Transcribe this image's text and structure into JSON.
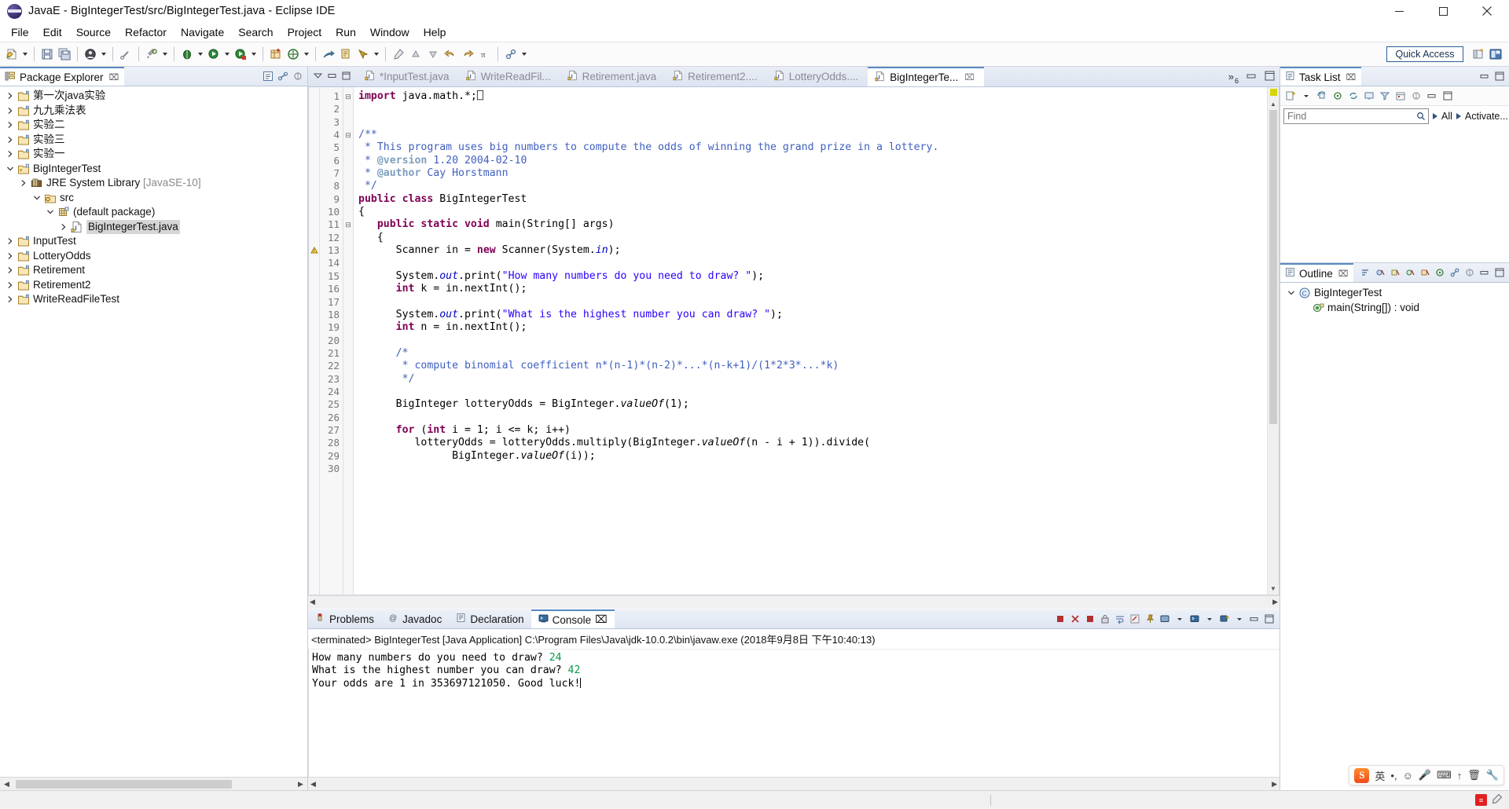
{
  "window": {
    "title": "JavaE - BigIntegerTest/src/BigIntegerTest.java - Eclipse IDE",
    "app_icon": "eclipse-icon",
    "minimize": "–",
    "maximize": "❐",
    "close": "✕"
  },
  "menu": [
    {
      "label": "File"
    },
    {
      "label": "Edit"
    },
    {
      "label": "Source"
    },
    {
      "label": "Refactor"
    },
    {
      "label": "Navigate"
    },
    {
      "label": "Search"
    },
    {
      "label": "Project"
    },
    {
      "label": "Run"
    },
    {
      "label": "Window"
    },
    {
      "label": "Help"
    }
  ],
  "toolbar": {
    "quick_access_placeholder": "Quick Access",
    "buttons": [
      "new-wizard-button",
      "new-wizard-dropdown",
      "save-button",
      "save-all-button",
      "print-button",
      "print-dropdown",
      "build-button",
      "external-tools-button",
      "external-tools-dropdown",
      "debug-button",
      "debug-dropdown",
      "run-button",
      "run-dropdown",
      "coverage-button",
      "coverage-dropdown",
      "new-java-project-button",
      "new-java-package-button",
      "new-java-package-dropdown",
      "open-type-button",
      "new-class-button",
      "search-button",
      "search-dropdown",
      "last-edit-button",
      "previous-annotation-button",
      "next-annotation-button",
      "back-button",
      "forward-button",
      "pi-button",
      "link-button",
      "link-dropdown"
    ],
    "perspective_buttons": [
      "open-perspective-button",
      "java-perspective-button"
    ]
  },
  "explorer": {
    "title": "Package Explorer",
    "close_glyph": "⌧",
    "toolbar": [
      "collapse-all-icon",
      "link-with-editor-icon",
      "view-menu-icon"
    ],
    "tree": [
      {
        "indent": 0,
        "twist": "right",
        "icon": "project-icon",
        "label": "第一次java实验"
      },
      {
        "indent": 0,
        "twist": "right",
        "icon": "project-icon",
        "label": "九九乘法表"
      },
      {
        "indent": 0,
        "twist": "right",
        "icon": "project-icon",
        "label": "实验二"
      },
      {
        "indent": 0,
        "twist": "right",
        "icon": "project-icon",
        "label": "实验三"
      },
      {
        "indent": 0,
        "twist": "right",
        "icon": "project-icon",
        "label": "实验一"
      },
      {
        "indent": 0,
        "twist": "down",
        "icon": "java-project-icon",
        "label": "BigIntegerTest"
      },
      {
        "indent": 1,
        "twist": "right",
        "icon": "jre-library-icon",
        "label": "JRE System Library",
        "dim": "[JavaSE-10]"
      },
      {
        "indent": 2,
        "twist": "down",
        "icon": "source-folder-icon",
        "label": "src"
      },
      {
        "indent": 3,
        "twist": "down",
        "icon": "package-icon",
        "label": "(default package)"
      },
      {
        "indent": 4,
        "twist": "right",
        "icon": "java-file-icon",
        "label": "BigIntegerTest.java",
        "selected": true
      },
      {
        "indent": 0,
        "twist": "right",
        "icon": "project-icon",
        "label": "InputTest"
      },
      {
        "indent": 0,
        "twist": "right",
        "icon": "project-icon",
        "label": "LotteryOdds"
      },
      {
        "indent": 0,
        "twist": "right",
        "icon": "project-icon",
        "label": "Retirement"
      },
      {
        "indent": 0,
        "twist": "right",
        "icon": "project-icon",
        "label": "Retirement2"
      },
      {
        "indent": 0,
        "twist": "right",
        "icon": "project-icon",
        "label": "WriteReadFileTest"
      }
    ]
  },
  "editor": {
    "left_icons": [
      "minimize-view-icon",
      "restore-view-icon",
      "maximize-view-icon"
    ],
    "tabs": [
      {
        "label": "*InputTest.java",
        "active": false
      },
      {
        "label": "WriteReadFil...",
        "active": false
      },
      {
        "label": "Retirement.java",
        "active": false
      },
      {
        "label": "Retirement2....",
        "active": false
      },
      {
        "label": "LotteryOdds....",
        "active": false
      },
      {
        "label": "BigIntegerTe...",
        "active": true,
        "close_glyph": "⌧"
      }
    ],
    "more_tabs": "»",
    "more_tabs_count": "6",
    "minimize_glyph": "–",
    "maximize_glyph": "❐",
    "first_line_number": 1,
    "lines": [
      {
        "n": 1,
        "fold": "⊟",
        "html": "<span class=\"kw\">import</span> java.math.*;<span class=\"sel-blk\">⎕</span>"
      },
      {
        "n": 2,
        "html": ""
      },
      {
        "n": 3,
        "html": ""
      },
      {
        "n": 4,
        "fold": "⊟",
        "html": "<span class=\"cm\">/**</span>"
      },
      {
        "n": 5,
        "html": "<span class=\"cm\"> * This program uses big numbers to compute the odds of winning the grand prize in a lottery.</span>"
      },
      {
        "n": 6,
        "html": "<span class=\"cm\"> * </span><span class=\"cmtag\">@version</span><span class=\"cm\"> 1.20 2004-02-10</span>"
      },
      {
        "n": 7,
        "html": "<span class=\"cm\"> * </span><span class=\"cmtag\">@author</span><span class=\"cm\"> Cay Horstmann</span>"
      },
      {
        "n": 8,
        "html": "<span class=\"cm\"> */</span>"
      },
      {
        "n": 9,
        "html": "<span class=\"kw\">public class</span> BigIntegerTest"
      },
      {
        "n": 10,
        "html": "{"
      },
      {
        "n": 11,
        "fold": "⊟",
        "html": "   <span class=\"kw\">public static void</span> main(String[] args)"
      },
      {
        "n": 12,
        "html": "   {"
      },
      {
        "n": 13,
        "mark": "warn",
        "html": "      Scanner <span class=\"lvar\">in</span> = <span class=\"kw\">new</span> Scanner(System.<span class=\"fld\">in</span>);"
      },
      {
        "n": 14,
        "html": ""
      },
      {
        "n": 15,
        "html": "      System.<span class=\"fld\">out</span>.print(<span class=\"str\">\"How many numbers do you need to draw? \"</span>);"
      },
      {
        "n": 16,
        "html": "      <span class=\"kw\">int</span> k = in.nextInt();"
      },
      {
        "n": 17,
        "html": ""
      },
      {
        "n": 18,
        "html": "      System.<span class=\"fld\">out</span>.print(<span class=\"str\">\"What is the highest number you can draw? \"</span>);"
      },
      {
        "n": 19,
        "html": "      <span class=\"kw\">int</span> n = in.nextInt();"
      },
      {
        "n": 20,
        "html": ""
      },
      {
        "n": 21,
        "html": "      <span class=\"cm\">/*</span>"
      },
      {
        "n": 22,
        "html": "<span class=\"cm\">       * compute binomial coefficient n*(n-1)*(n-2)*...*(n-k+1)/(1*2*3*...*k)</span>"
      },
      {
        "n": 23,
        "html": "<span class=\"cm\">       */</span>"
      },
      {
        "n": 24,
        "html": ""
      },
      {
        "n": 25,
        "html": "      BigInteger lotteryOdds = BigInteger.<span class=\"stat\">valueOf</span>(1);"
      },
      {
        "n": 26,
        "html": ""
      },
      {
        "n": 27,
        "html": "      <span class=\"kw\">for</span> (<span class=\"kw\">int</span> i = 1; i &lt;= k; i++)"
      },
      {
        "n": 28,
        "html": "         lotteryOdds = lotteryOdds.multiply(BigInteger.<span class=\"stat\">valueOf</span>(n - i + 1)).divide("
      },
      {
        "n": 29,
        "html": "               BigInteger.<span class=\"stat\">valueOf</span>(i));"
      },
      {
        "n": 30,
        "html": ""
      }
    ]
  },
  "console": {
    "tabs": [
      {
        "label": "Problems",
        "icon": "problems-icon",
        "active": false
      },
      {
        "label": "Javadoc",
        "icon": "javadoc-icon",
        "active": false
      },
      {
        "label": "Declaration",
        "icon": "declaration-icon",
        "active": false
      },
      {
        "label": "Console",
        "icon": "console-icon",
        "active": true,
        "close_glyph": "⌧"
      }
    ],
    "toolbar": [
      "terminate-all-icon",
      "remove-launch-icon",
      "remove-all-terminated-icon",
      "scroll-lock-icon",
      "word-wrap-icon",
      "clear-console-icon",
      "pin-console-icon",
      "display-selected-console-icon",
      "display-console-dropdown-icon",
      "open-console-icon",
      "open-console-dropdown-icon",
      "new-console-view-icon",
      "new-console-dropdown-icon",
      "minimize-icon",
      "maximize-icon"
    ],
    "header": "<terminated> BigIntegerTest [Java Application] C:\\Program Files\\Java\\jdk-10.0.2\\bin\\javaw.exe (2018年9月8日 下午10:40:13)",
    "lines": [
      {
        "prompt": "How many numbers do you need to draw? ",
        "value": "24"
      },
      {
        "prompt": "What is the highest number you can draw? ",
        "value": "42"
      },
      {
        "prompt": "Your odds are 1 in 353697121050. Good luck!",
        "value": "",
        "caret": true
      }
    ]
  },
  "task_list": {
    "title": "Task List",
    "close_glyph": "⌧",
    "toolbar": [
      "new-task-icon",
      "new-task-dropdown-icon",
      "restore-tasks-icon",
      "focus-on-workweek-icon",
      "synchronize-changed-icon",
      "presentation-icon",
      "filter-icon",
      "schedule-icon",
      "task-view-menu-icon",
      "minimize-icon",
      "maximize-icon"
    ],
    "find_placeholder": "Find",
    "find_value": "",
    "find_icon": "search-icon",
    "all_label": "All",
    "activate_label": "Activate...",
    "help_icon": "help-icon"
  },
  "outline": {
    "title": "Outline",
    "close_glyph": "⌧",
    "toolbar": [
      "sort-icon",
      "hide-fields-icon",
      "hide-static-icon",
      "hide-nonpublic-icon",
      "hide-local-types-icon",
      "focus-icon",
      "link-icon",
      "view-menu-icon",
      "minimize-icon",
      "maximize-icon"
    ],
    "items": [
      {
        "indent": 0,
        "twist": "down",
        "icon": "class-icon",
        "label": "BigIntegerTest"
      },
      {
        "indent": 1,
        "twist": "none",
        "icon": "method-public-static-icon",
        "label": "main(String[]) : void"
      }
    ]
  },
  "ime": {
    "logo": "S",
    "items": [
      "英",
      "•,",
      "☺",
      "🎤",
      "⌨",
      "↑",
      "🗑",
      "🔧"
    ]
  },
  "statusbar": {
    "right_badge": "≡",
    "pen_icon": "pen-icon"
  },
  "colors": {
    "accent": "#5a8ac6",
    "keyword": "#7f0055",
    "comment": "#3f5fbf",
    "string": "#2a00ff",
    "field": "#0000c0",
    "console_value": "#0a9b4a",
    "selection": "#d6d6d6"
  }
}
